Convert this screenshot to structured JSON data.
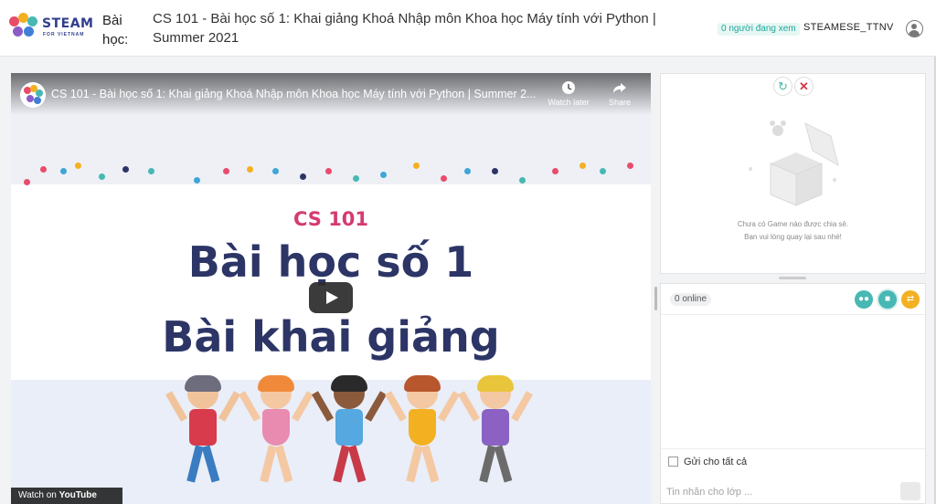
{
  "colors": {
    "brand": "#2f3e8e",
    "accent_teal": "#47b8b4",
    "accent_orange": "#f3b021",
    "slide_pink": "#d63a72",
    "slide_navy": "#2c3566",
    "danger": "#d33a4a"
  },
  "header": {
    "logo_text": "STEAM",
    "logo_sub": "FOR VIETNAM",
    "lesson_label": "Bài học:",
    "lesson_title": "CS 101 - Bài học số 1: Khai giảng Khoá Nhập môn Khoa học Máy tính với Python | Summer 2021",
    "viewers": "0 người đang xem",
    "username": "STEAMESE_TTNV",
    "user_icon": "user-circle-icon"
  },
  "video": {
    "yt_title": "CS 101 - Bài học số 1: Khai giảng Khoá Nhập môn Khoa học Máy tính với Python | Summer 2...",
    "watch_later": "Watch later",
    "share": "Share",
    "slide_course": "CS 101",
    "slide_line1": "Bài học số 1",
    "slide_line2": "Bài khai giảng",
    "watch_on_prefix": "Watch on",
    "watch_on_brand": "YouTube",
    "play_icon": "play-icon"
  },
  "game_panel": {
    "refresh_icon": "refresh-icon",
    "close_icon": "close-icon",
    "empty_line1": "Chưa có Game nào được chia sẻ.",
    "empty_line2": "Bạn vui lòng quay lại sau nhé!"
  },
  "chat": {
    "online": "0 online",
    "send_all_label": "Gửi cho tất cả",
    "message_placeholder": "Tin nhắn cho lớp ..."
  }
}
